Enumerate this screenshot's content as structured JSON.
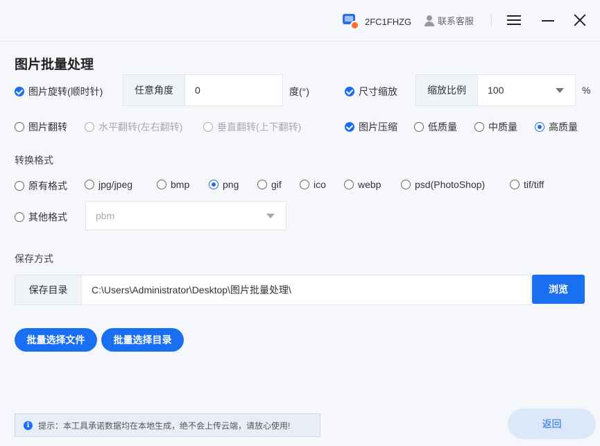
{
  "titlebar": {
    "user_name": "2FC1FHZG",
    "support_label": "联系客服"
  },
  "page_title": "图片批量处理",
  "rotate": {
    "label": "图片旋转(顺时针)",
    "checked": true,
    "angle_label": "任意角度",
    "angle_value": "0",
    "unit": "度(°)"
  },
  "resize": {
    "label": "尺寸缩放",
    "checked": true,
    "ratio_label": "缩放比例",
    "ratio_value": "100",
    "unit": "%"
  },
  "flip": {
    "label": "图片翻转",
    "horizontal": "水平翻转(左右翻转)",
    "vertical": "垂直翻转(上下翻转)"
  },
  "compress": {
    "label": "图片压缩",
    "checked": true,
    "low": "低质量",
    "mid": "中质量",
    "high": "高质量",
    "selected": "高质量"
  },
  "format": {
    "section_label": "转换格式",
    "options": [
      "原有格式",
      "jpg/jpeg",
      "bmp",
      "png",
      "gif",
      "ico",
      "webp",
      "psd(PhotoShop)",
      "tif/tiff"
    ],
    "selected": "png",
    "other_label": "其他格式",
    "other_value": "pbm"
  },
  "save": {
    "section_label": "保存方式",
    "dir_label": "保存目录",
    "dir_value": "C:\\Users\\Administrator\\Desktop\\图片批量处理\\",
    "browse_label": "浏览"
  },
  "actions": {
    "select_files": "批量选择文件",
    "select_dir": "批量选择目录"
  },
  "footer": {
    "tip": "提示：本工具承诺数据均在本地生成，绝不会上传云端，请放心使用!",
    "back": "返回"
  },
  "colors": {
    "accent": "#1a6ff1",
    "background": "#f5f7fb"
  }
}
